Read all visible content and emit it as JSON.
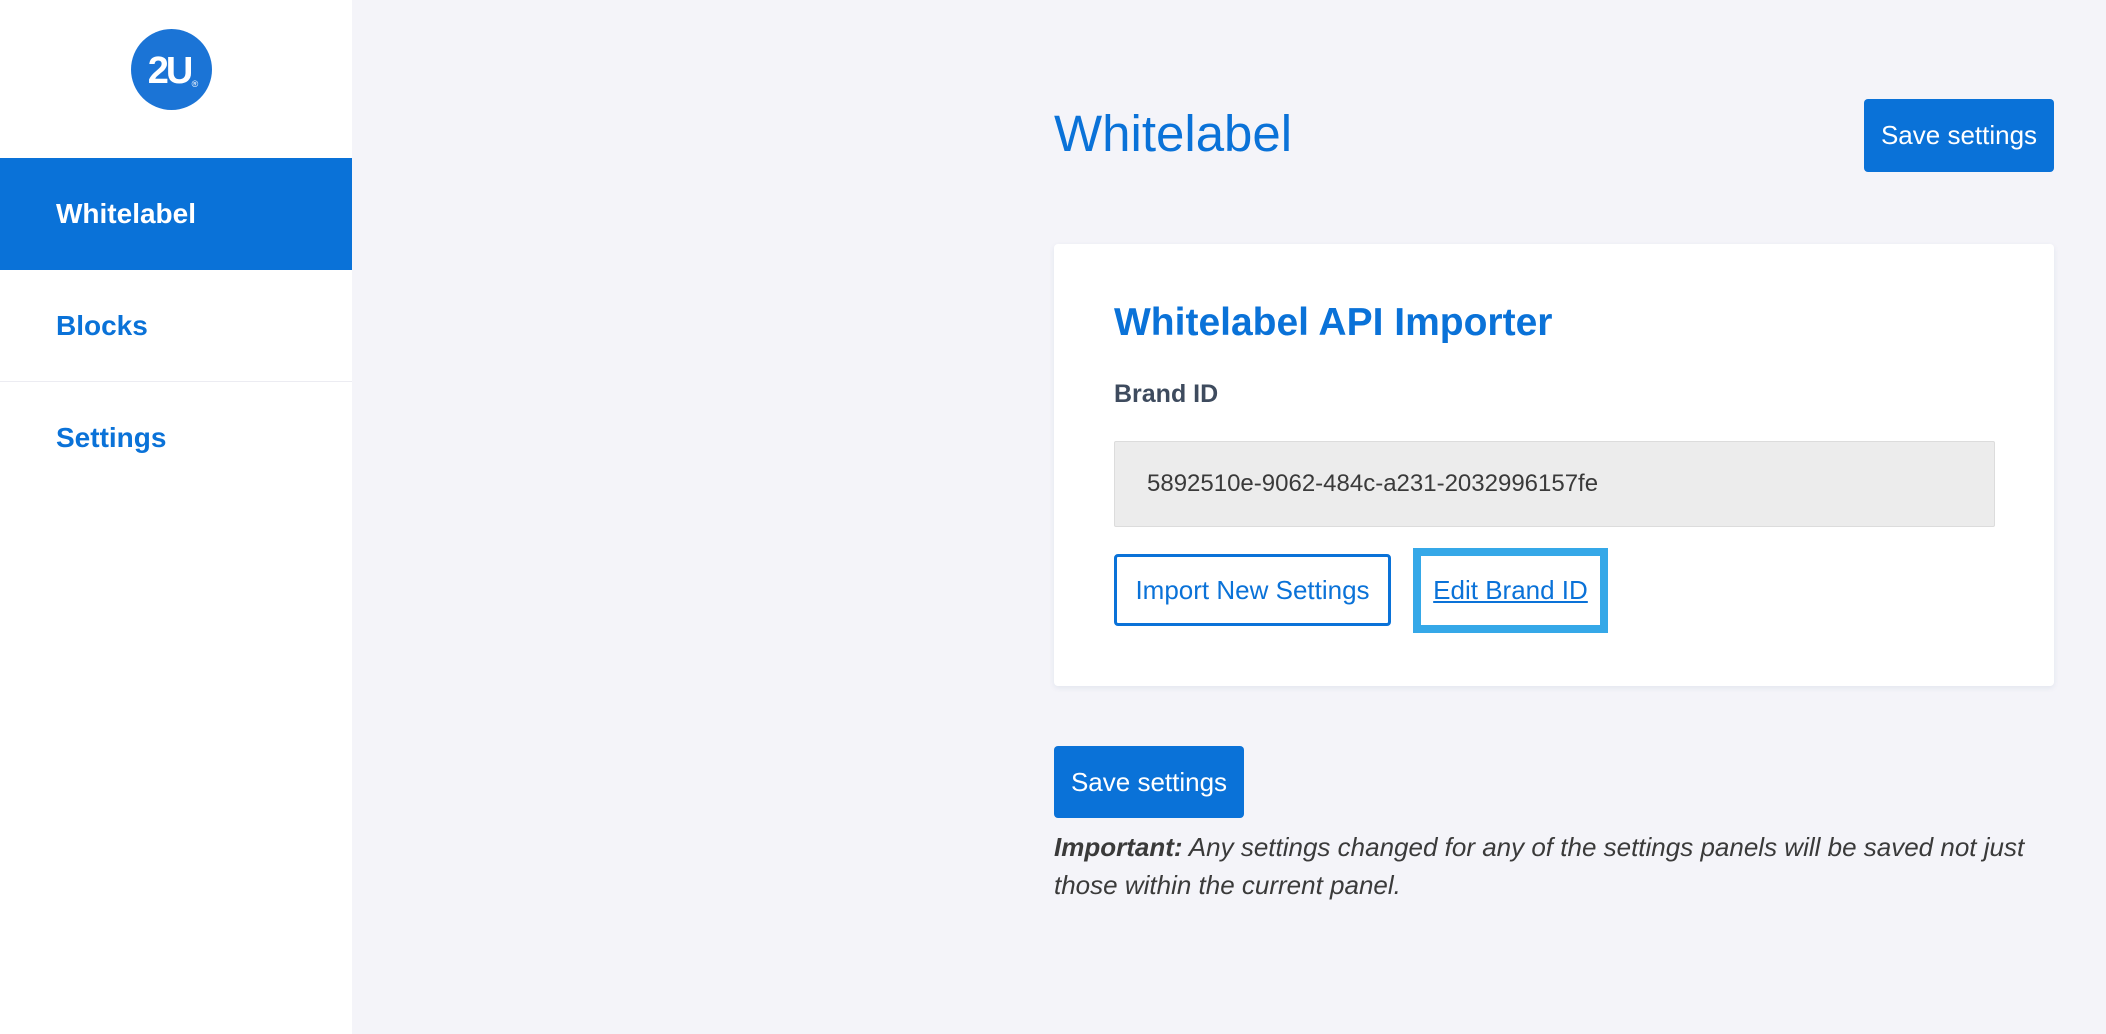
{
  "brand": {
    "logo_text": "2U",
    "logo_mark": "®",
    "color": "#1b74d6"
  },
  "sidebar": {
    "items": [
      {
        "label": "Whitelabel",
        "active": true
      },
      {
        "label": "Blocks",
        "active": false
      },
      {
        "label": "Settings",
        "active": false
      }
    ]
  },
  "header": {
    "title": "Whitelabel",
    "save_label": "Save settings"
  },
  "importer": {
    "title": "Whitelabel API Importer",
    "brand_id_label": "Brand ID",
    "brand_id_value": "5892510e-9062-484c-a231-2032996157fe",
    "import_label": "Import New Settings",
    "edit_label": "Edit Brand ID"
  },
  "footer": {
    "save_label": "Save settings",
    "note_strong": "Important:",
    "note_text": " Any settings changed for any of the settings panels will be saved not just those within the current panel."
  },
  "colors": {
    "accent": "#0a72d8",
    "focus_ring": "#35a8e8",
    "background": "#f4f4f9"
  }
}
